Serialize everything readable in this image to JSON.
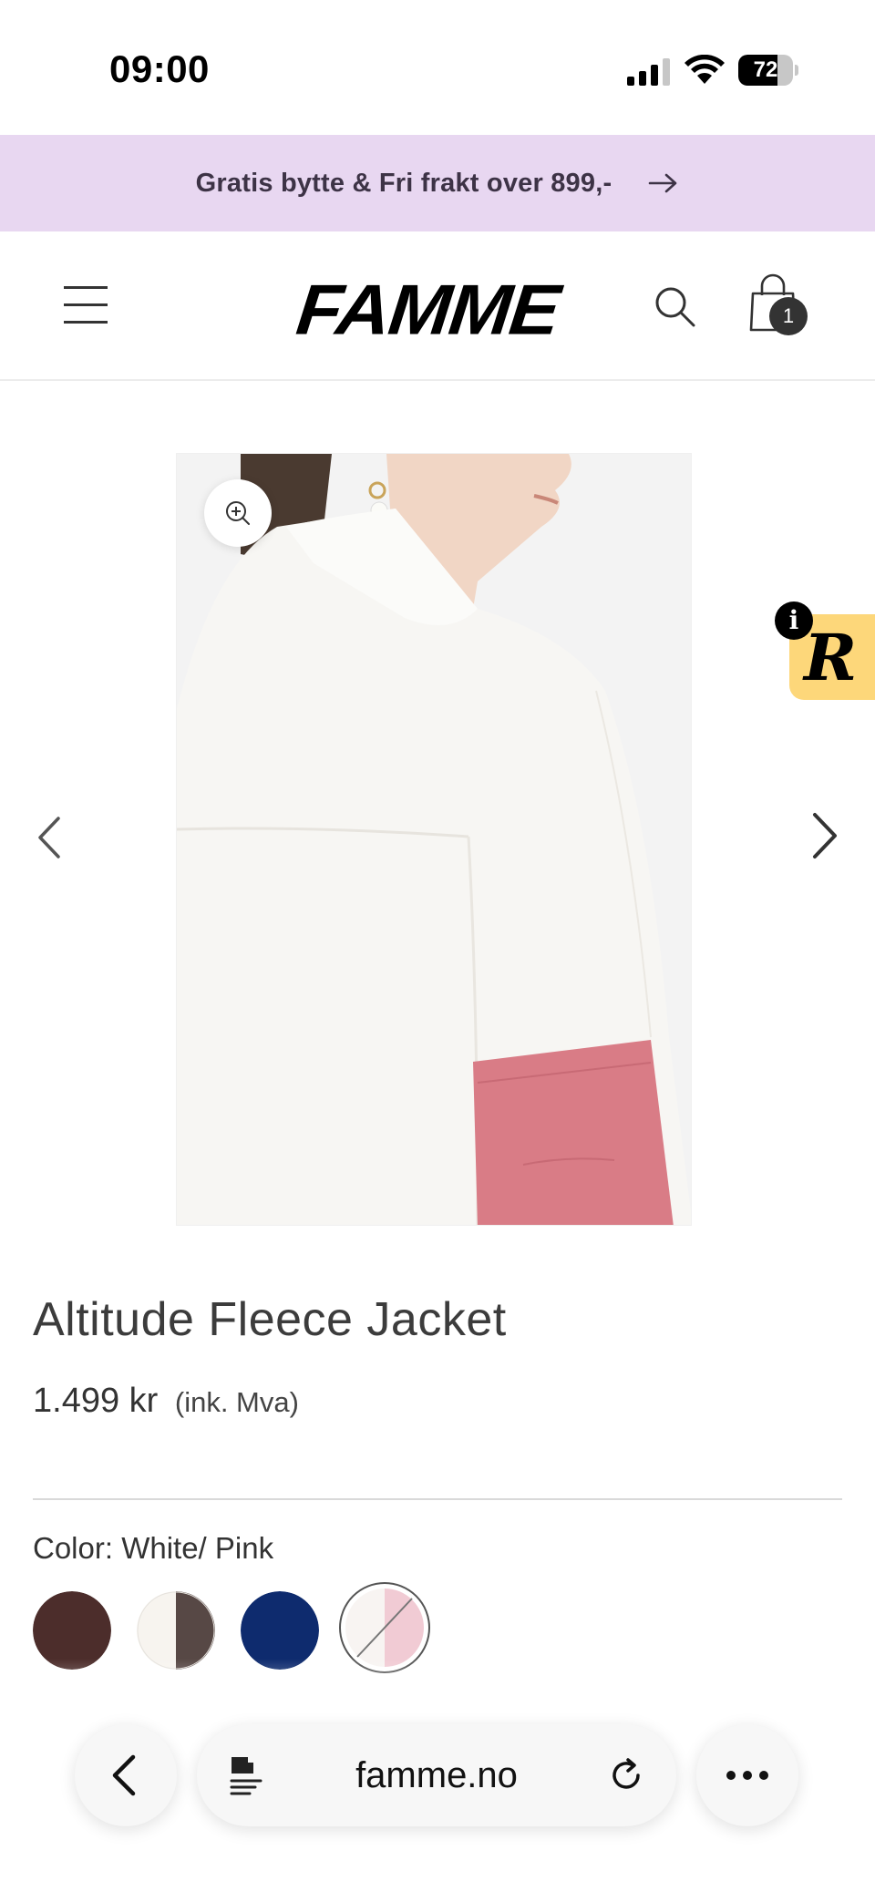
{
  "status_bar": {
    "time": "09:00",
    "battery_level": "72",
    "battery_fraction": 0.72
  },
  "promo_banner": {
    "text": "Gratis bytte & Fri frakt over 899,-",
    "icon": "arrow-right-icon"
  },
  "header": {
    "logo": "FAMME",
    "menu_icon": "hamburger-menu-icon",
    "search_icon": "search-icon",
    "cart_icon": "shopping-bag-icon",
    "cart_count": "1"
  },
  "gallery": {
    "zoom_icon": "zoom-in-icon",
    "prev_icon": "chevron-left-icon",
    "next_icon": "chevron-right-icon",
    "accent_colors": {
      "background": "#f3f3f3",
      "jacket": "#f7f6f3",
      "pocket": "#d97c86",
      "hair": "#4a3a30"
    }
  },
  "floating_badge": {
    "letter": "R",
    "info": "i",
    "color": "#fdd77a"
  },
  "product": {
    "title": "Altitude Fleece Jacket",
    "price": "1.499 kr",
    "price_note": "(ink. Mva)",
    "color_label": "Color: White/ Pink",
    "swatches": [
      {
        "color_a": "#4c2d2b",
        "color_b": "#4c2d2b",
        "selected": false
      },
      {
        "color_a": "#f7f4ef",
        "color_b": "#574845",
        "selected": false
      },
      {
        "color_a": "#0e2b6e",
        "color_b": "#0e2b6e",
        "selected": false
      },
      {
        "color_a": "#f8f4f2",
        "color_b": "#f1cbd4",
        "selected": true
      }
    ]
  },
  "browser": {
    "url": "famme.no",
    "back_icon": "chevron-left-icon",
    "reader_icon": "page-menu-icon",
    "reload_icon": "reload-icon",
    "more_icon": "more-dots-icon"
  }
}
